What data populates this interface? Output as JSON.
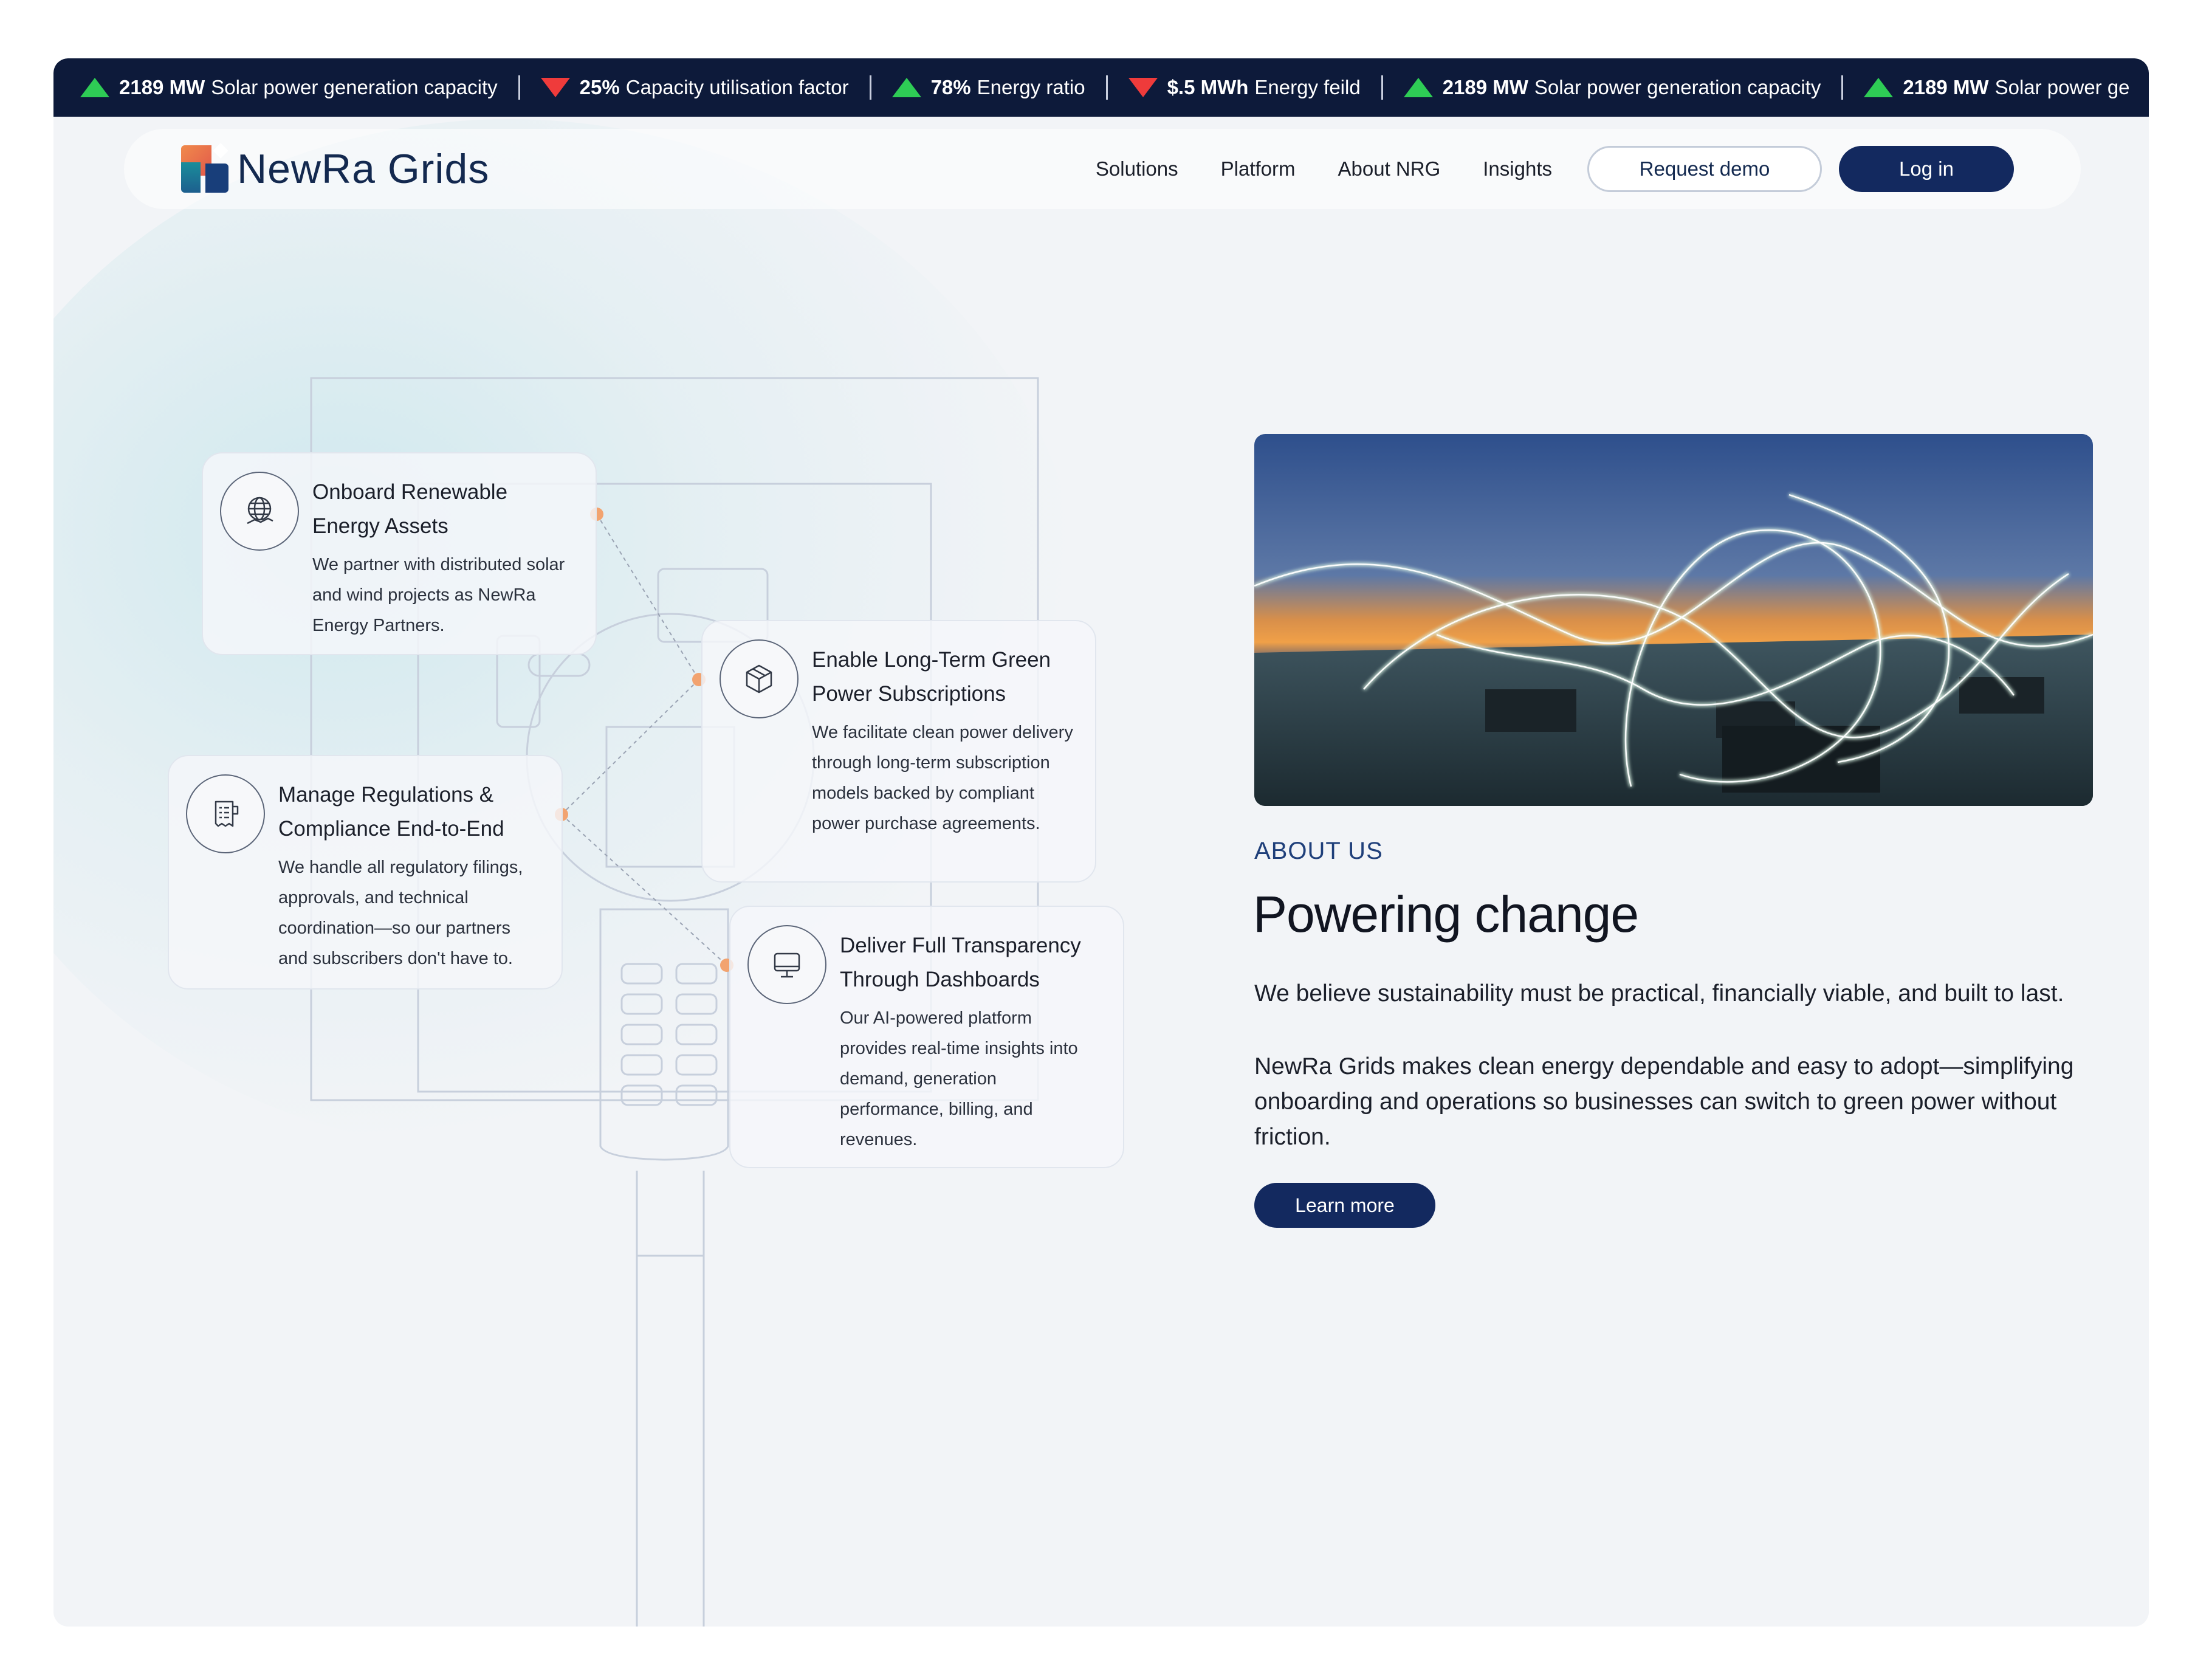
{
  "ticker": [
    {
      "dir": "up",
      "value": "2189 MW",
      "label": "Solar power generation capacity"
    },
    {
      "dir": "down",
      "value": "25%",
      "label": "Capacity utilisation factor"
    },
    {
      "dir": "up",
      "value": "78%",
      "label": "Energy ratio"
    },
    {
      "dir": "down",
      "value": "$.5 MWh",
      "label": "Energy feild"
    },
    {
      "dir": "up",
      "value": "2189 MW",
      "label": "Solar power generation capacity"
    },
    {
      "dir": "up",
      "value": "2189 MW",
      "label": "Solar power ge"
    }
  ],
  "brand": {
    "name": "NewRa Grids"
  },
  "nav": {
    "links": [
      "Solutions",
      "Platform",
      "About NRG",
      "Insights"
    ],
    "request_demo": "Request demo",
    "login": "Log in"
  },
  "cards": [
    {
      "title": "Onboard Renewable Energy Assets",
      "desc": "We partner with distributed solar and wind projects as NewRa Energy Partners.",
      "icon": "globe-handshake-icon"
    },
    {
      "title": "Enable Long-Term Green Power Subscriptions",
      "desc": "We facilitate clean power delivery through long-term subscription models backed by compliant power purchase agreements.",
      "icon": "cube-icon"
    },
    {
      "title": "Manage Regulations & Compliance End-to-End",
      "desc": "We handle all regulatory filings, approvals, and technical coordination—so our partners and subscribers don't have to.",
      "icon": "document-icon"
    },
    {
      "title": "Deliver Full Transparency Through Dashboards",
      "desc": "Our AI-powered platform provides real-time insights into demand, generation performance, billing, and revenues.",
      "icon": "monitor-icon"
    }
  ],
  "about": {
    "label": "ABOUT US",
    "headline": "Powering change",
    "para1": "We believe sustainability must be practical, financially viable, and built to last.",
    "para2": "NewRa Grids makes clean energy dependable and easy to adopt—simplifying onboarding and operations so businesses can switch to green power without friction.",
    "cta": "Learn more"
  },
  "colors": {
    "navy": "#13295f",
    "ticker_bg": "#0d1a3a",
    "up": "#2ecc55",
    "down": "#ef3b3b",
    "accent_dot": "#f2a36f"
  }
}
